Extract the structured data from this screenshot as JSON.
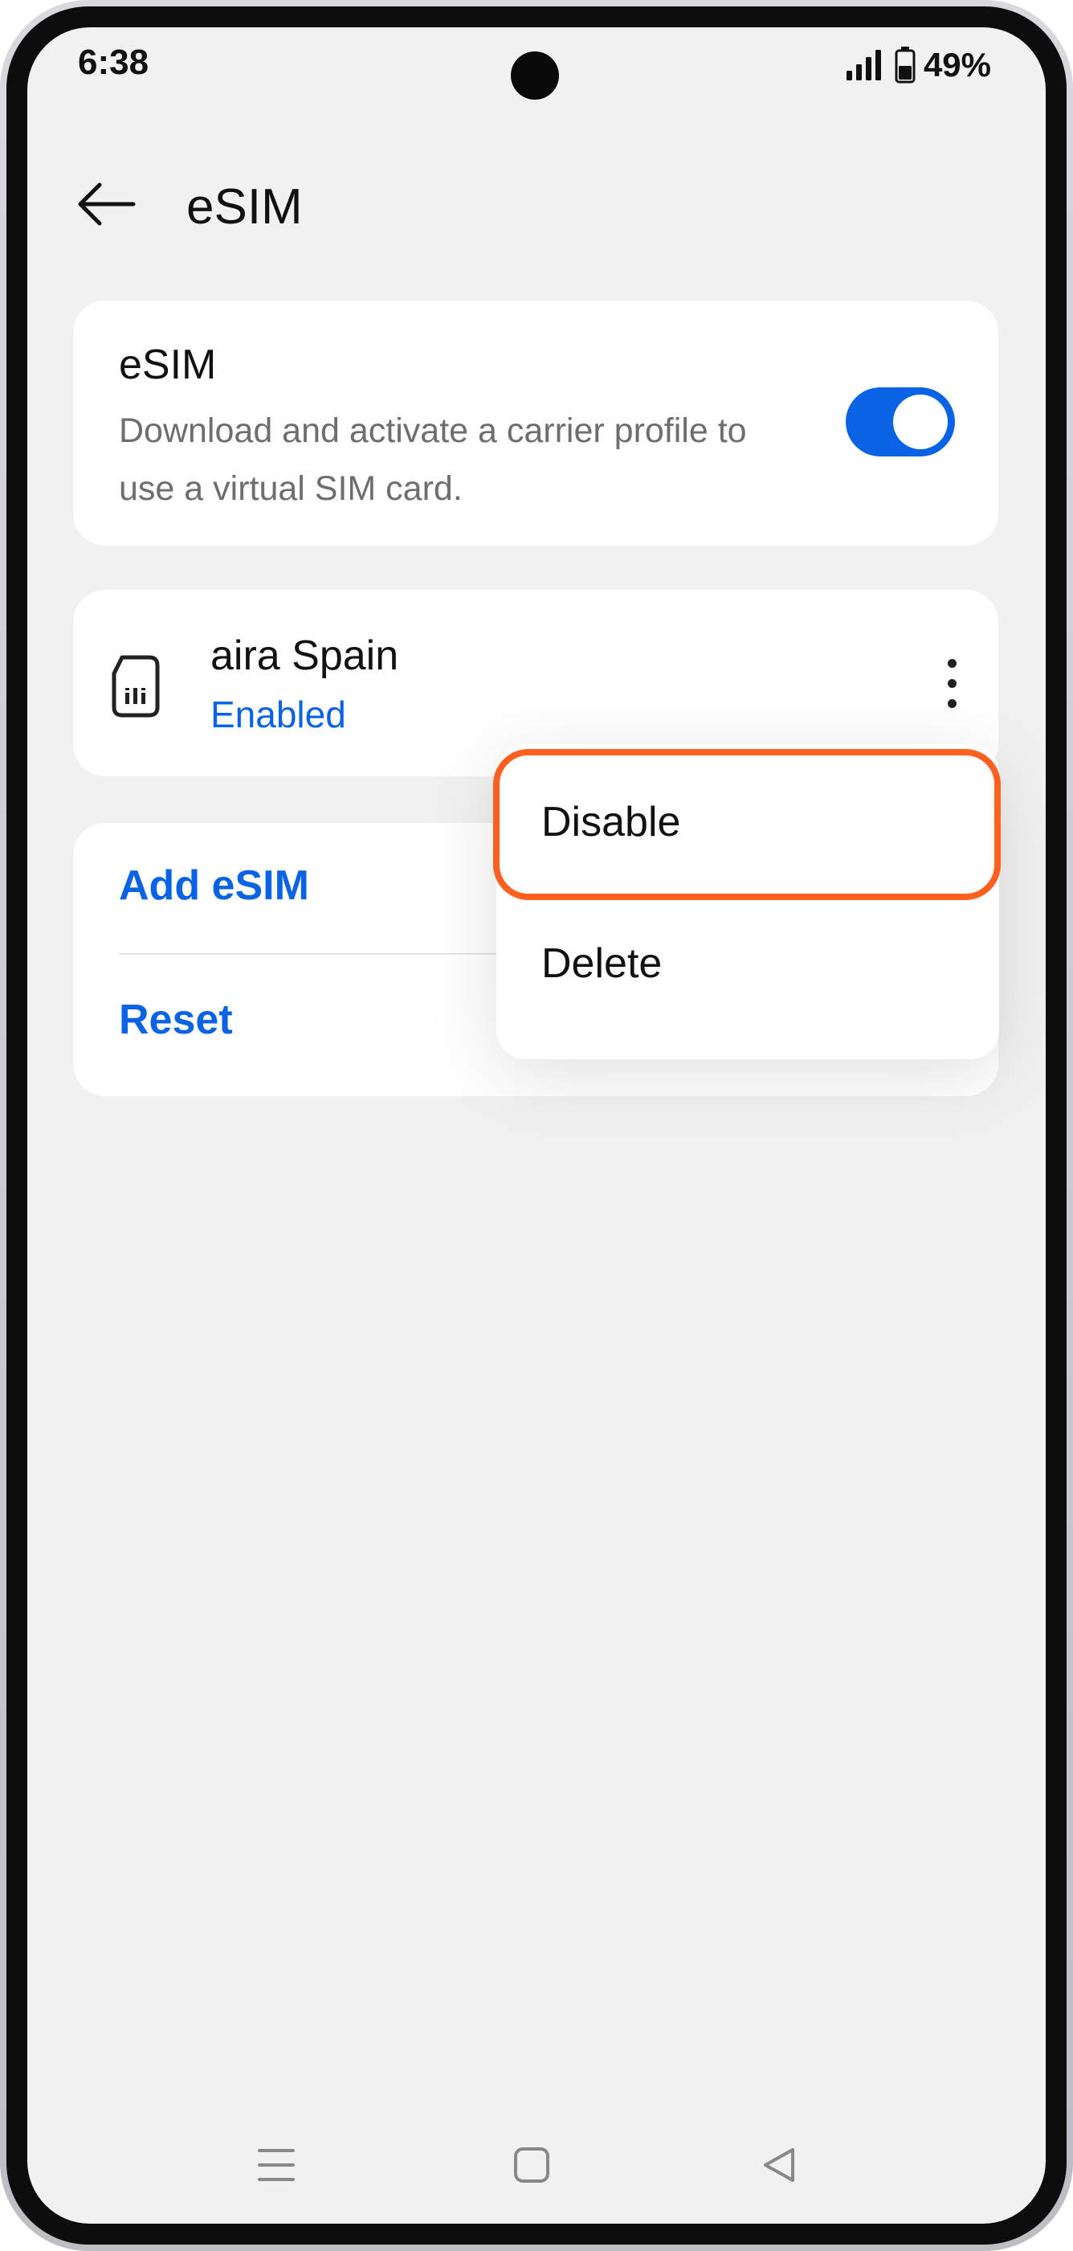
{
  "status_bar": {
    "time": "6:38",
    "battery": "49%",
    "icons": [
      "signal-icon",
      "battery-icon"
    ]
  },
  "header": {
    "title": "eSIM",
    "back_icon": "back-arrow-icon"
  },
  "esim_card": {
    "title": "eSIM",
    "description": "Download and activate a carrier profile to use a virtual SIM card.",
    "toggle_on": true
  },
  "profile": {
    "name": "aira Spain",
    "status": "Enabled",
    "icon": "sim-card-icon",
    "more_icon": "more-vertical-icon"
  },
  "actions": {
    "add_label": "Add eSIM",
    "reset_label": "Reset"
  },
  "menu": {
    "items": [
      {
        "label": "Disable",
        "highlighted": true
      },
      {
        "label": "Delete",
        "highlighted": false
      }
    ]
  },
  "nav": {
    "icons": [
      "recents-icon",
      "home-icon",
      "back-icon"
    ]
  },
  "colors": {
    "accent": "#0a63e4",
    "highlight": "#ff5f1f",
    "background": "#f1f1f1"
  }
}
